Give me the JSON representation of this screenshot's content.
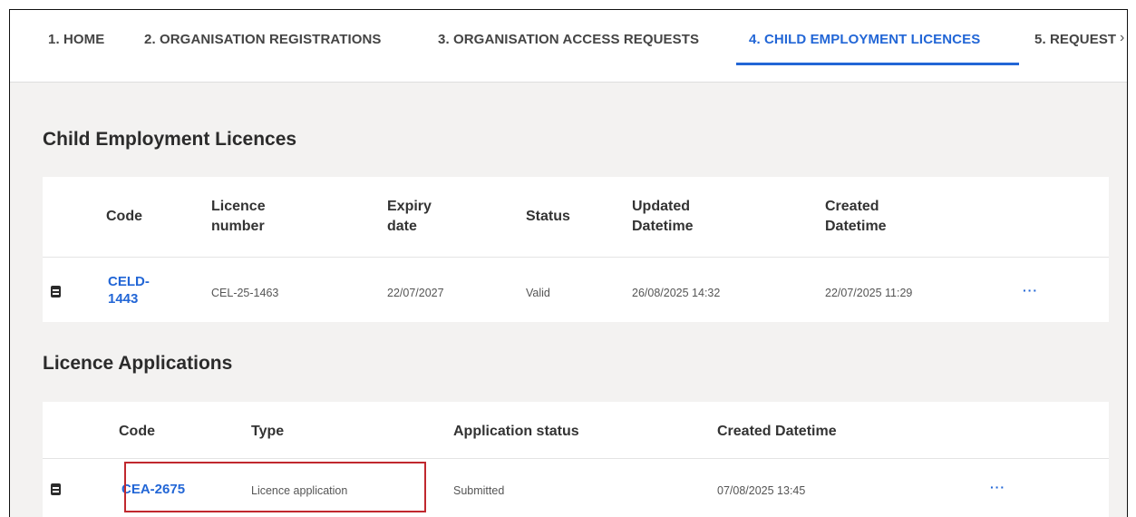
{
  "tabs": [
    {
      "label": "1. HOME"
    },
    {
      "label": "2. ORGANISATION REGISTRATIONS"
    },
    {
      "label": "3. ORGANISATION ACCESS REQUESTS"
    },
    {
      "label": "4. CHILD EMPLOYMENT LICENCES",
      "active": true
    },
    {
      "label": "5. REQUEST"
    }
  ],
  "tab_scroll_icon": "chevron-right-icon",
  "licences": {
    "title": "Child Employment Licences",
    "headers": {
      "code": "Code",
      "licence_number_1": "Licence",
      "licence_number_2": "number",
      "expiry_1": "Expiry",
      "expiry_2": "date",
      "status": "Status",
      "updated_1": "Updated",
      "updated_2": "Datetime",
      "created_1": "Created",
      "created_2": "Datetime"
    },
    "rows": [
      {
        "code_1": "CELD-",
        "code_2": "1443",
        "licence_number": "CEL-25-1463",
        "expiry_date": "22/07/2027",
        "status": "Valid",
        "updated": "26/08/2025 14:32",
        "created": "22/07/2025 11:29",
        "actions": "···"
      }
    ]
  },
  "applications": {
    "title": "Licence Applications",
    "headers": {
      "code": "Code",
      "type": "Type",
      "application_status": "Application status",
      "created": "Created Datetime"
    },
    "rows": [
      {
        "code": "CEA-2675",
        "type": "Licence application",
        "application_status": "Submitted",
        "created": "07/08/2025 13:45",
        "actions": "···"
      }
    ]
  },
  "colors": {
    "accent": "#2266d6",
    "highlight": "#c0282e",
    "page_background": "#f3f2f1"
  }
}
